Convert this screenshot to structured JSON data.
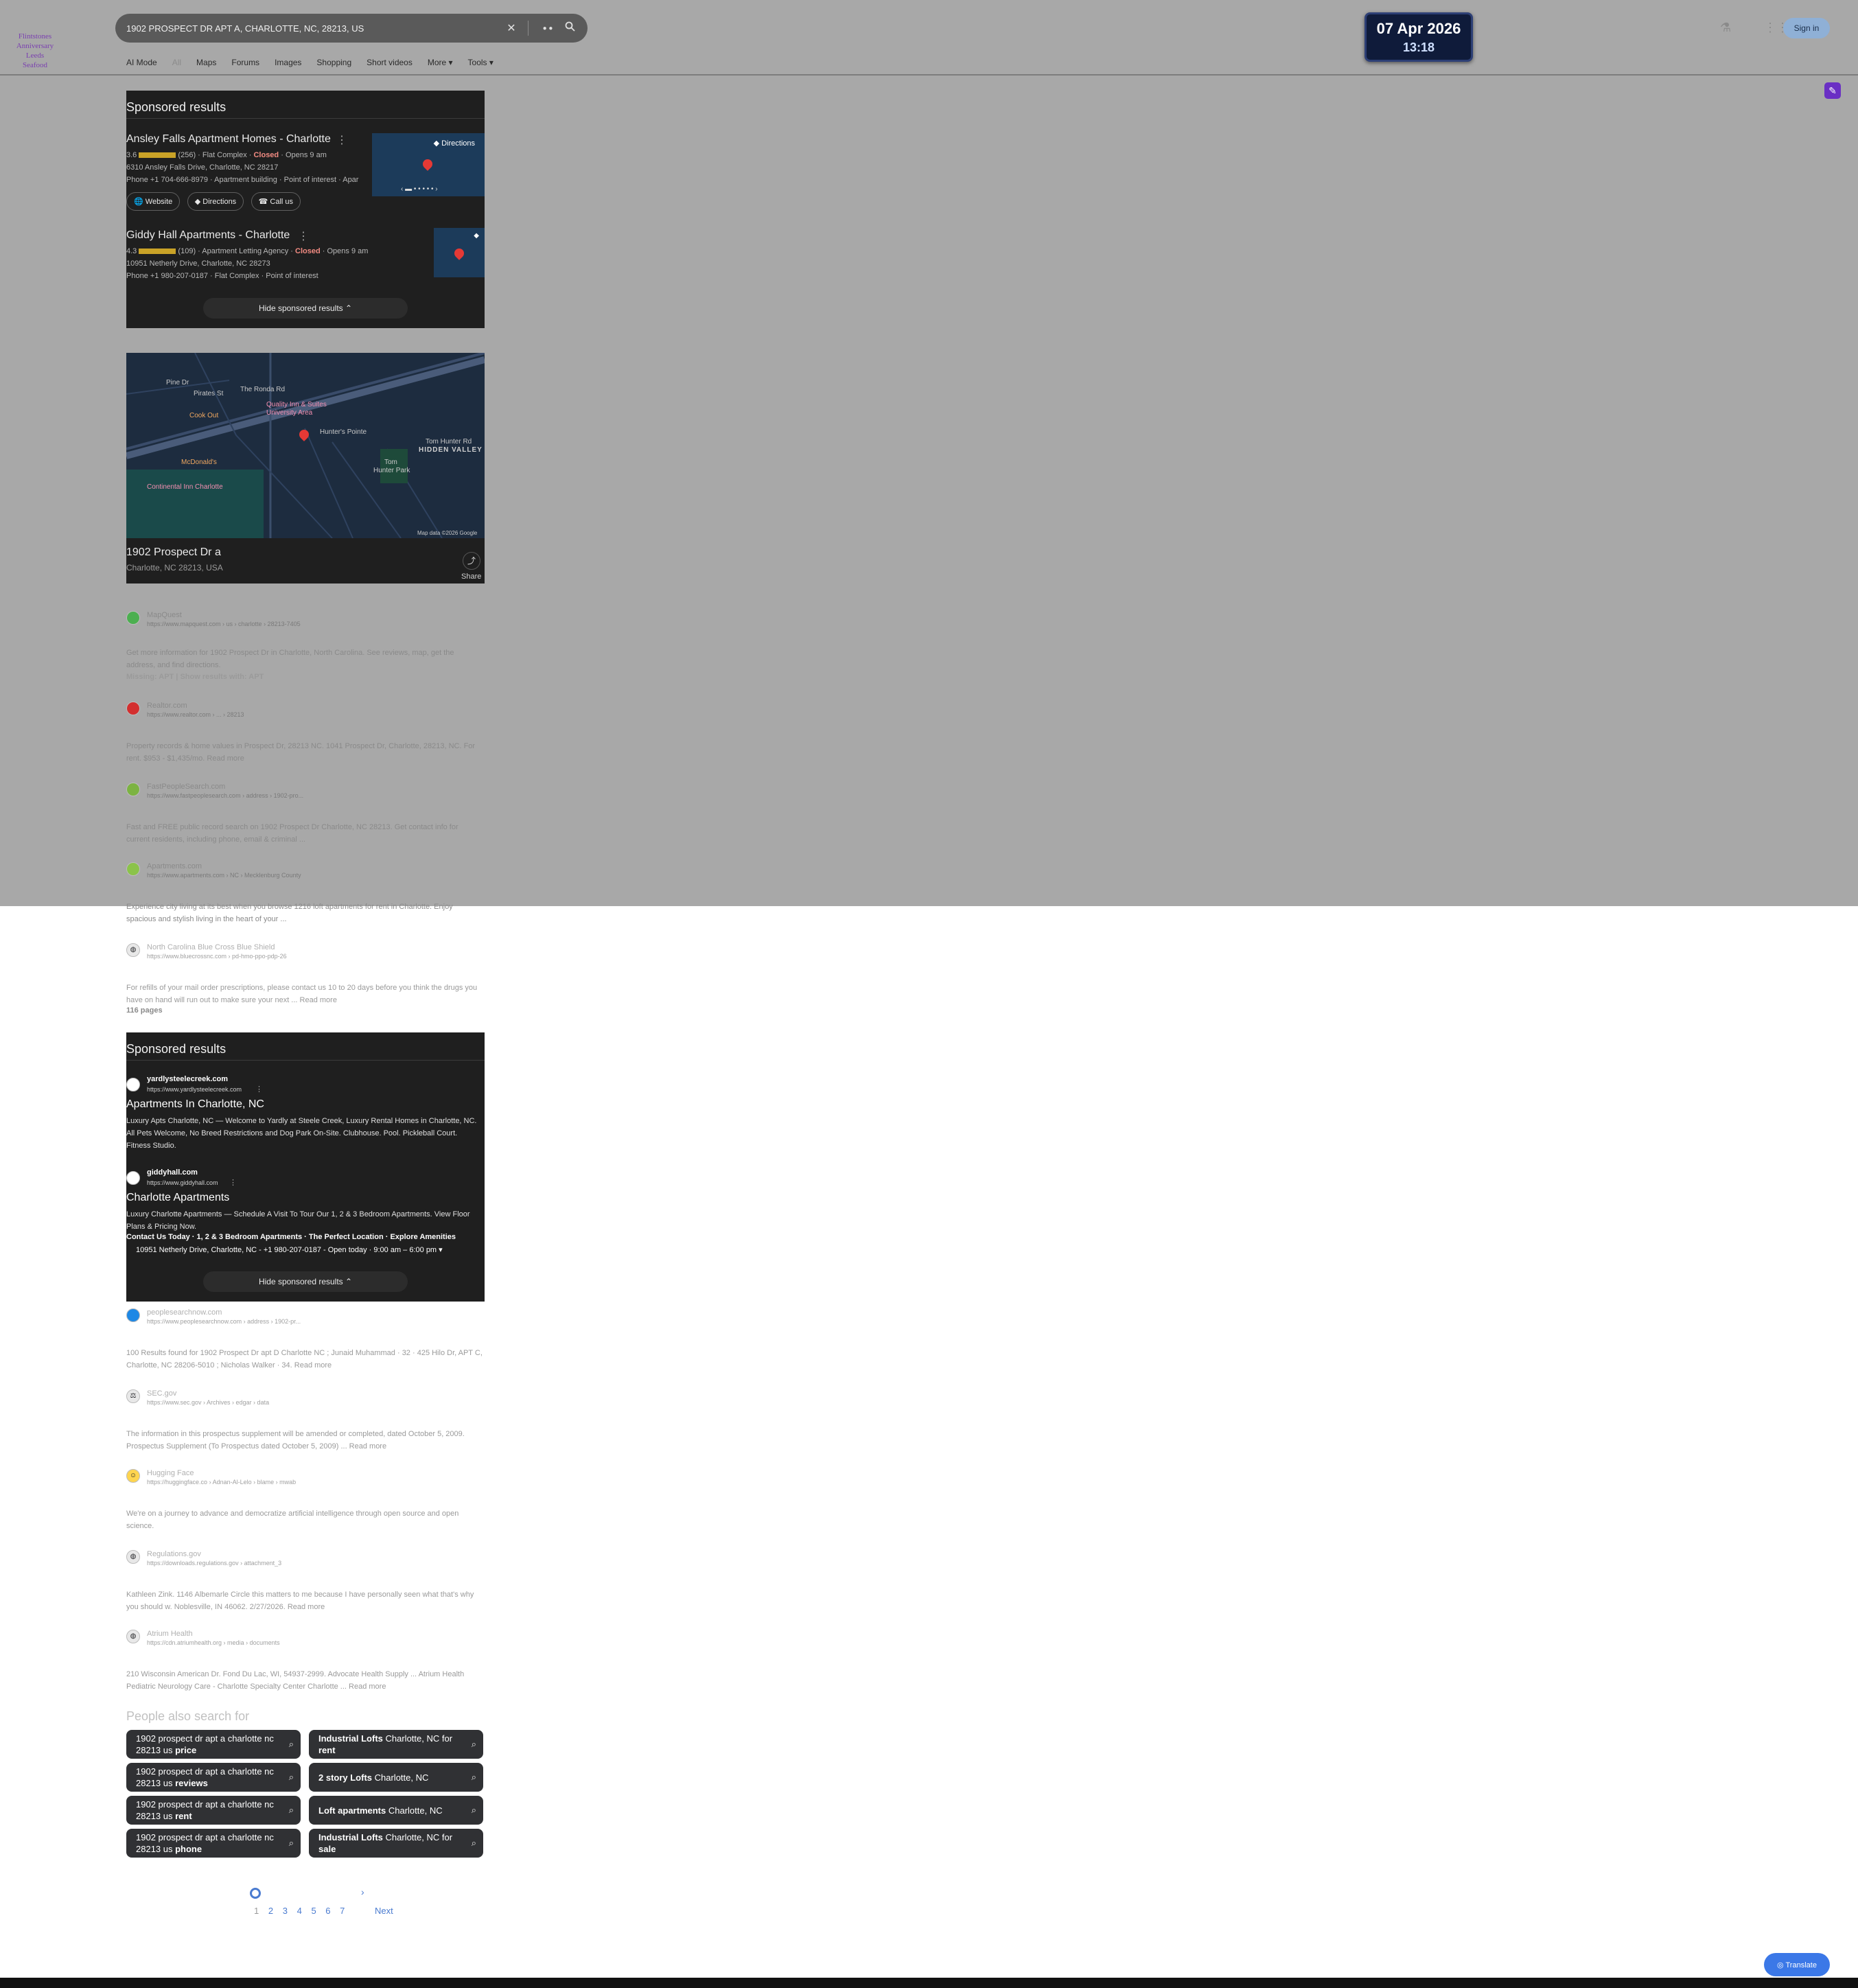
{
  "search": {
    "query": "1902 PROSPECT DR APT A, CHARLOTTE, NC, 28213, US"
  },
  "logo": {
    "lines": [
      "Flintstones",
      "Anniversary",
      "Leeds",
      "Seafood"
    ]
  },
  "clock": {
    "date": "07 Apr 2026",
    "time": "13:18"
  },
  "header": {
    "signin": "Sign in"
  },
  "tabs": [
    "AI Mode",
    "All",
    "Maps",
    "Forums",
    "Images",
    "Shopping",
    "Short videos",
    "More ▾",
    "Tools ▾"
  ],
  "sponsored1": {
    "title": "Sponsored results",
    "items": [
      {
        "name": "Ansley Falls Apartment Homes - Charlotte",
        "rating": "3.6",
        "reviews": "(256)",
        "category": "Flat Complex",
        "status": "Closed",
        "opens": "Opens 9 am",
        "address": "6310 Ansley Falls Drive, Charlotte, NC 28217",
        "phone": "Phone +1 704-666-8979 · Apartment building · Point of interest · Apar",
        "directions": "Directions",
        "buttons": [
          "Website",
          "Directions",
          "Call us"
        ]
      },
      {
        "name": "Giddy Hall Apartments - Charlotte",
        "rating": "4.3",
        "reviews": "(109)",
        "category": "Apartment Letting Agency",
        "status": "Closed",
        "opens": "Opens 9 am",
        "address": "10951 Netherly Drive, Charlotte, NC 28273",
        "phone": "Phone +1 980-207-0187 · Flat Complex · Point of interest"
      }
    ],
    "hide": "Hide sponsored results"
  },
  "map": {
    "labels": {
      "pine": "Pine Dr",
      "pirates": "Pirates St",
      "ronda": "The Ronda Rd",
      "quality1": "Quality Inn & Suites",
      "quality2": "University Area",
      "cookout": "Cook Out",
      "hunters": "Hunter's Pointe",
      "tomhunter": "Tom Hunter Rd",
      "hidden": "HIDDEN VALLEY",
      "tomhunterpark1": "Tom",
      "tomhunterpark2": "Hunter Park",
      "mcd": "McDonald's",
      "continental": "Continental Inn Charlotte",
      "credit": "Map data ©2026 Google"
    },
    "place": "1902 Prospect Dr a",
    "locality": "Charlotte, NC 28213, USA",
    "share": "Share"
  },
  "results": [
    {
      "site": "MapQuest",
      "url": "https://www.mapquest.com › us › charlotte › 28213-7405",
      "snippet": "Get more information for 1902 Prospect Dr in Charlotte, North Carolina. See reviews, map, get the address, and find directions.",
      "extra": "Missing: APT | Show results with: APT"
    },
    {
      "site": "Realtor.com",
      "url": "https://www.realtor.com › ... › 28213",
      "snippet": "Property records & home values in Prospect Dr, 28213 NC. 1041 Prospect Dr, Charlotte, 28213, NC. For rent. $953 - $1,435/mo.  Read more"
    },
    {
      "site": "FastPeopleSearch.com",
      "url": "https://www.fastpeoplesearch.com › address › 1902-pro...",
      "snippet": "Fast and FREE public record search on 1902 Prospect Dr Charlotte, NC 28213. Get contact info for current residents, including phone, email & criminal ..."
    },
    {
      "site": "Apartments.com",
      "url": "https://www.apartments.com › NC › Mecklenburg County",
      "snippet": "Experience city living at its best when you browse 1216 loft apartments for rent in Charlotte. Enjoy spacious and stylish living in the heart of your ..."
    },
    {
      "site": "North Carolina Blue Cross Blue Shield",
      "url": "https://www.bluecrossnc.com › pd-hmo-ppo-pdp-26",
      "snippet": "For refills of your mail order prescriptions, please contact us 10 to 20 days before you think the drugs you have on hand will run out to make sure your next ...  Read more",
      "extra": "116 pages"
    }
  ],
  "sponsored2": {
    "title": "Sponsored results",
    "ads": [
      {
        "domain": "yardlysteelecreek.com",
        "url": "https://www.yardlysteelecreek.com",
        "headline": "Apartments In Charlotte, NC",
        "desc": "Luxury Apts Charlotte, NC — Welcome to Yardly at Steele Creek, Luxury Rental Homes in Charlotte, NC. All Pets Welcome, No Breed Restrictions and Dog Park On-Site. Clubhouse. Pool. Pickleball Court. Fitness Studio."
      },
      {
        "domain": "giddyhall.com",
        "url": "https://www.giddyhall.com",
        "headline": "Charlotte Apartments",
        "desc": "Luxury Charlotte Apartments — Schedule A Visit To Tour Our 1, 2 & 3 Bedroom Apartments. View Floor Plans & Pricing Now.",
        "links": "Contact Us Today · 1, 2 & 3 Bedroom Apartments · The Perfect Location · Explore Amenities",
        "address": "10951 Netherly Drive, Charlotte, NC - +1 980-207-0187 - Open today · 9:00 am – 6:00 pm ▾"
      }
    ],
    "hide": "Hide sponsored results"
  },
  "results2": [
    {
      "site": "peoplesearchnow.com",
      "url": "https://www.peoplesearchnow.com › address › 1902-pr...",
      "snippet": "100 Results found for 1902 Prospect Dr apt D Charlotte NC ; Junaid Muhammad · 32 · 425 Hilo Dr, APT C, Charlotte, NC 28206-5010 ; Nicholas Walker · 34.  Read more"
    },
    {
      "site": "SEC.gov",
      "url": "https://www.sec.gov › Archives › edgar › data",
      "snippet": "The information in this prospectus supplement will be amended or completed, dated October 5, 2009. Prospectus Supplement (To Prospectus dated October 5, 2009) ...  Read more"
    },
    {
      "site": "Hugging Face",
      "url": "https://huggingface.co › Adnan-Al-Lelo › blame › mwab",
      "snippet": "We're on a journey to advance and democratize artificial intelligence through open source and open science."
    },
    {
      "site": "Regulations.gov",
      "url": "https://downloads.regulations.gov › attachment_3",
      "snippet": "Kathleen Zink. 1146 Albemarle Circle this matters to me because I have personally seen what that's why you should w. Noblesville, IN 46062. 2/27/2026.  Read more"
    },
    {
      "site": "Atrium Health",
      "url": "https://cdn.atriumhealth.org › media › documents",
      "snippet": "210 Wisconsin American Dr. Fond Du Lac, WI, 54937-2999. Advocate Health Supply ... Atrium Health Pediatric Neurology Care - Charlotte Specialty Center Charlotte ...  Read more"
    }
  ],
  "pas": {
    "title": "People also search for",
    "chips": [
      {
        "pre": "1902 prospect dr apt a charlotte nc 28213 us ",
        "bold": "price",
        "post": ""
      },
      {
        "pre": "",
        "bold": "Industrial Lofts",
        "post": " Charlotte, NC for ",
        "bold2": "rent"
      },
      {
        "pre": "1902 prospect dr apt a charlotte nc 28213 us ",
        "bold": "reviews",
        "post": ""
      },
      {
        "pre": "",
        "bold": "2 story Lofts",
        "post": " Charlotte, NC"
      },
      {
        "pre": "1902 prospect dr apt a charlotte nc 28213 us ",
        "bold": "rent",
        "post": ""
      },
      {
        "pre": "",
        "bold": "Loft apartments",
        "post": " Charlotte, NC"
      },
      {
        "pre": "1902 prospect dr apt a charlotte nc 28213 us ",
        "bold": "phone",
        "post": ""
      },
      {
        "pre": "",
        "bold": "Industrial Lofts",
        "post": " Charlotte, NC for ",
        "bold2": "sale"
      }
    ]
  },
  "pagination": {
    "pages": [
      "1",
      "2",
      "3",
      "4",
      "5",
      "6",
      "7"
    ],
    "next": "Next"
  },
  "translate": "Translate"
}
